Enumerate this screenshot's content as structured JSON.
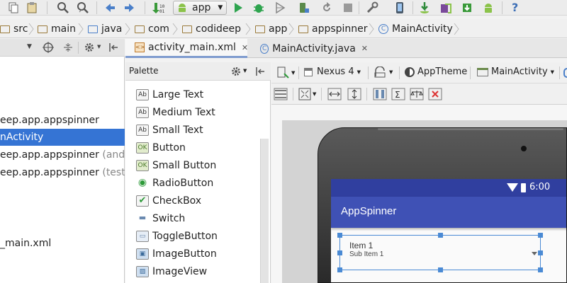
{
  "toolbar": {
    "run_config": "app",
    "icons": [
      "copy-icon",
      "paste-icon",
      "find-icon",
      "replace-icon",
      "back-icon",
      "forward-icon",
      "make-project-icon",
      "android-icon",
      "run-icon",
      "debug-icon",
      "coverage-icon",
      "attach-debugger-icon",
      "rerun-icon",
      "stop-icon",
      "sync-gradle-icon",
      "avd-manager-icon",
      "sdk-manager-icon",
      "android-monitor-icon",
      "help-icon"
    ]
  },
  "breadcrumbs": [
    "src",
    "main",
    "java",
    "com",
    "codideep",
    "app",
    "appspinner",
    "MainActivity"
  ],
  "project_panel": {
    "rows": [
      {
        "text": "eep.app.appspinner",
        "suffix": ""
      },
      {
        "text": "nActivity",
        "suffix": "",
        "selected": true
      },
      {
        "text": "eep.app.appspinner",
        "suffix": "(androi"
      },
      {
        "text": "eep.app.appspinner",
        "suffix": "(test)"
      },
      {
        "text": "_main.xml",
        "suffix": ""
      }
    ]
  },
  "editor_tabs": [
    {
      "label": "activity_main.xml",
      "active": true
    },
    {
      "label": "MainActivity.java",
      "active": false
    }
  ],
  "palette": {
    "title": "Palette",
    "items": [
      {
        "label": "Large Text",
        "icon": "Ab"
      },
      {
        "label": "Medium Text",
        "icon": "Ab"
      },
      {
        "label": "Small Text",
        "icon": "Ab"
      },
      {
        "label": "Button",
        "icon": "OK"
      },
      {
        "label": "Small Button",
        "icon": "OK"
      },
      {
        "label": "RadioButton",
        "icon": "◉"
      },
      {
        "label": "CheckBox",
        "icon": "✔"
      },
      {
        "label": "Switch",
        "icon": "▬"
      },
      {
        "label": "ToggleButton",
        "icon": "▭"
      },
      {
        "label": "ImageButton",
        "icon": "▣"
      },
      {
        "label": "ImageView",
        "icon": "▨"
      }
    ]
  },
  "designer": {
    "device": "Nexus 4",
    "theme": "AppTheme",
    "activity": "MainActivity"
  },
  "phone": {
    "status_time": "6:00",
    "app_title": "AppSpinner",
    "spinner_item": "Item 1",
    "spinner_sub": "Sub Item 1"
  },
  "colors": {
    "accent": "#3574d4",
    "app_bar": "#3f51b5",
    "status_bar": "#303f9f"
  }
}
